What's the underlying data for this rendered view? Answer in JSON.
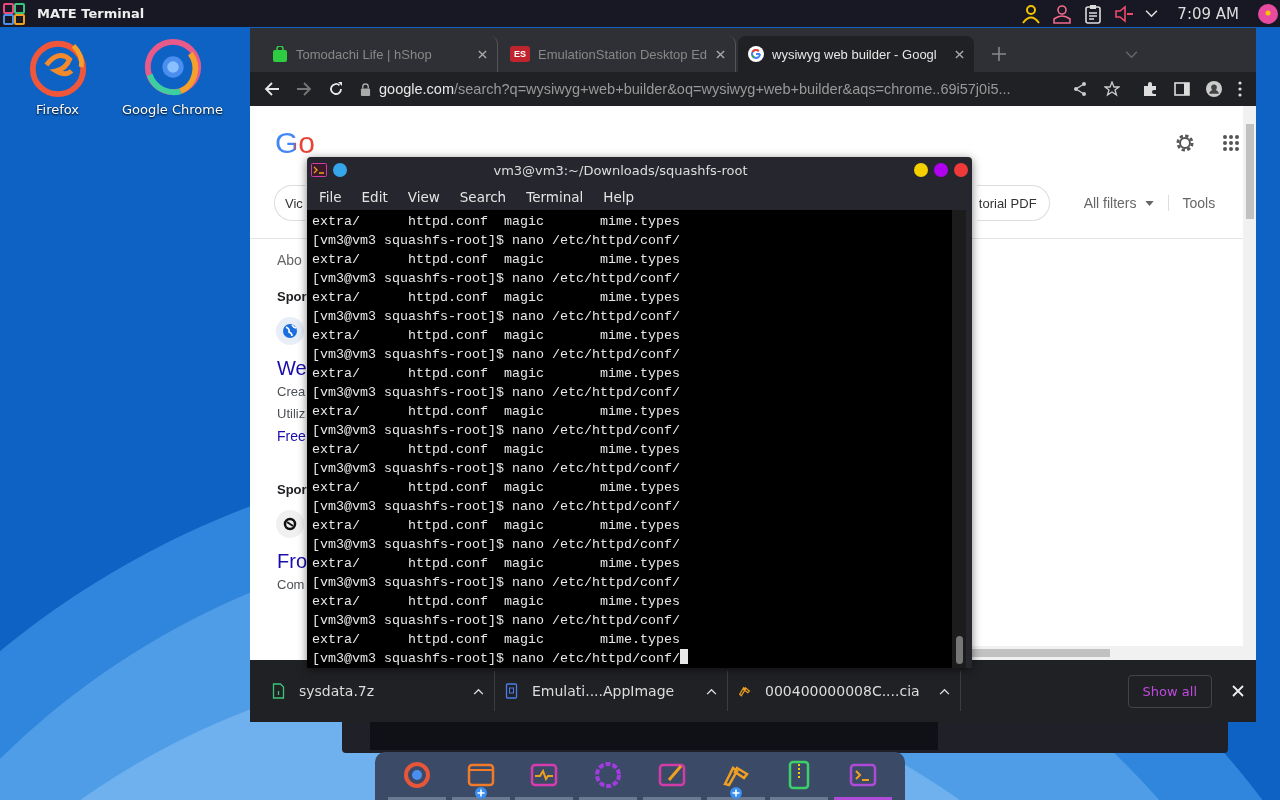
{
  "top_panel": {
    "app_title": "MATE Terminal",
    "clock": "7:09 AM"
  },
  "desktop_icons": [
    {
      "label": "Firefox",
      "kind": "firefox"
    },
    {
      "label": "Google Chrome",
      "kind": "chrome"
    }
  ],
  "browser": {
    "tabs": [
      {
        "title": "Tomodachi Life | hShop",
        "kind": "hshop",
        "selected": false
      },
      {
        "title": "EmulationStation Desktop Ed",
        "kind": "es",
        "favicon_text": "ES",
        "selected": false
      },
      {
        "title": "wysiwyg web builder - Googl",
        "kind": "google",
        "selected": true
      }
    ],
    "url_host": "google.com",
    "url_path": "/search?q=wysiwyg+web+builder&oq=wysiwyg+web+builder&aqs=chrome..69i57j0i5...",
    "page": {
      "logo": "Go",
      "chips": [
        "Vic",
        "torial PDF"
      ],
      "all_filters": "All filters",
      "tools": "Tools",
      "about": "Abo",
      "ads": [
        {
          "heading": "Spor",
          "kind": "globe",
          "title": "We",
          "lines": [
            "Crea",
            "Utiliz"
          ],
          "link": "Free"
        },
        {
          "heading": "Spor",
          "kind": "ring",
          "title": "Fro",
          "lines": [
            "Com"
          ]
        }
      ]
    },
    "downloads": [
      {
        "name": "sysdata.7z",
        "kind": "archive"
      },
      {
        "name": "Emulati....AppImage",
        "kind": "appimage"
      },
      {
        "name": "000400000008C....cia",
        "kind": "cia"
      }
    ],
    "show_all": "Show all"
  },
  "terminal": {
    "title": "vm3@vm3:~/Downloads/squashfs-root",
    "menu": [
      "File",
      "Edit",
      "View",
      "Search",
      "Terminal",
      "Help"
    ],
    "lines": [
      "extra/      httpd.conf  magic       mime.types",
      "[vm3@vm3 squashfs-root]$ nano /etc/httpd/conf/",
      "extra/      httpd.conf  magic       mime.types",
      "[vm3@vm3 squashfs-root]$ nano /etc/httpd/conf/",
      "extra/      httpd.conf  magic       mime.types",
      "[vm3@vm3 squashfs-root]$ nano /etc/httpd/conf/",
      "extra/      httpd.conf  magic       mime.types",
      "[vm3@vm3 squashfs-root]$ nano /etc/httpd/conf/",
      "extra/      httpd.conf  magic       mime.types",
      "[vm3@vm3 squashfs-root]$ nano /etc/httpd/conf/",
      "extra/      httpd.conf  magic       mime.types",
      "[vm3@vm3 squashfs-root]$ nano /etc/httpd/conf/",
      "extra/      httpd.conf  magic       mime.types",
      "[vm3@vm3 squashfs-root]$ nano /etc/httpd/conf/",
      "extra/      httpd.conf  magic       mime.types",
      "[vm3@vm3 squashfs-root]$ nano /etc/httpd/conf/",
      "extra/      httpd.conf  magic       mime.types",
      "[vm3@vm3 squashfs-root]$ nano /etc/httpd/conf/",
      "extra/      httpd.conf  magic       mime.types",
      "[vm3@vm3 squashfs-root]$ nano /etc/httpd/conf/",
      "extra/      httpd.conf  magic       mime.types",
      "[vm3@vm3 squashfs-root]$ nano /etc/httpd/conf/",
      "extra/      httpd.conf  magic       mime.types",
      "[vm3@vm3 squashfs-root]$ nano /etc/httpd/conf/"
    ]
  },
  "dock": [
    {
      "kind": "chrome",
      "badge": false,
      "selected": false
    },
    {
      "kind": "files",
      "badge": true,
      "selected": false
    },
    {
      "kind": "monitor",
      "badge": false,
      "selected": false
    },
    {
      "kind": "settings",
      "badge": false,
      "selected": false
    },
    {
      "kind": "editor",
      "badge": false,
      "selected": false
    },
    {
      "kind": "cia",
      "badge": true,
      "selected": false
    },
    {
      "kind": "archive",
      "badge": false,
      "selected": false
    },
    {
      "kind": "terminal",
      "badge": false,
      "selected": true
    }
  ]
}
